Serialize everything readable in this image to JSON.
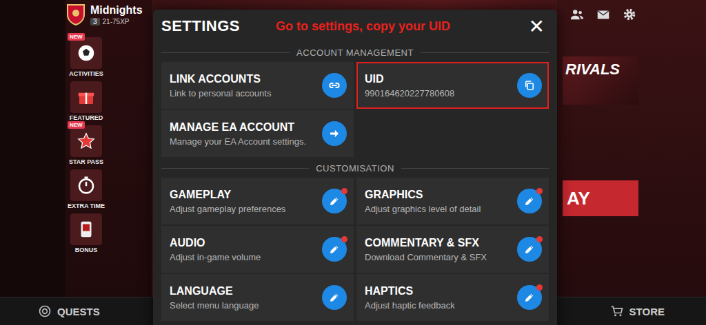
{
  "hud": {
    "club_name": "Midnights",
    "level": "3",
    "xp": "21-75XP"
  },
  "side_menu": [
    {
      "label": "ACTIVITIES",
      "badge": "NEW",
      "kind": "activities"
    },
    {
      "label": "FEATURED",
      "badge": null,
      "kind": "featured"
    },
    {
      "label": "STAR PASS",
      "badge": "NEW",
      "kind": "starpass"
    },
    {
      "label": "EXTRA TIME",
      "badge": null,
      "kind": "extratime"
    },
    {
      "label": "BONUS",
      "badge": null,
      "kind": "bonus"
    }
  ],
  "promo": {
    "title": "RIVALS",
    "play": "AY"
  },
  "bottom_bar": {
    "left": "QUESTS",
    "right": "STORE"
  },
  "dialog": {
    "title": "SETTINGS",
    "close": "✕",
    "annotation": "Go to settings, copy your UID",
    "sections": [
      {
        "header": "ACCOUNT MANAGEMENT",
        "items": [
          {
            "title": "LINK ACCOUNTS",
            "subtitle": "Link to personal accounts",
            "kind": "link",
            "notify": false,
            "highlighted": false
          },
          {
            "title": "UID",
            "subtitle": "990164620227780608",
            "kind": "copy",
            "notify": false,
            "highlighted": true
          },
          {
            "title": "MANAGE EA ACCOUNT",
            "subtitle": "Manage your EA Account settings.",
            "kind": "arrow",
            "notify": false,
            "highlighted": false
          }
        ]
      },
      {
        "header": "CUSTOMISATION",
        "items": [
          {
            "title": "GAMEPLAY",
            "subtitle": "Adjust gameplay preferences",
            "kind": "edit",
            "notify": true,
            "highlighted": false
          },
          {
            "title": "GRAPHICS",
            "subtitle": "Adjust graphics level of detail",
            "kind": "edit",
            "notify": true,
            "highlighted": false
          },
          {
            "title": "AUDIO",
            "subtitle": "Adjust in-game volume",
            "kind": "edit",
            "notify": true,
            "highlighted": false
          },
          {
            "title": "COMMENTARY & SFX",
            "subtitle": "Download Commentary & SFX",
            "kind": "edit",
            "notify": true,
            "highlighted": false
          },
          {
            "title": "LANGUAGE",
            "subtitle": "Select menu language",
            "kind": "edit",
            "notify": false,
            "highlighted": false
          },
          {
            "title": "HAPTICS",
            "subtitle": "Adjust haptic feedback",
            "kind": "edit",
            "notify": true,
            "highlighted": false
          }
        ]
      }
    ]
  }
}
